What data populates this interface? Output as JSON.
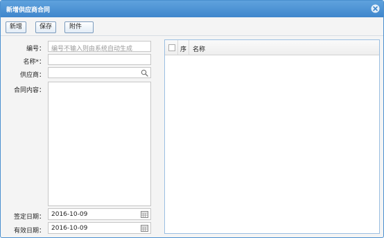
{
  "window": {
    "title": "新增供应商合同"
  },
  "toolbar": {
    "new_label": "新增",
    "save_label": "保存",
    "attach_label": "附件"
  },
  "form": {
    "code_label": "编号：",
    "code_placeholder": "编号不输入则由系统自动生成",
    "name_label": "名称",
    "name_required": "*",
    "name_colon": "：",
    "supplier_label": "供应商：",
    "content_label": "合同内容：",
    "sign_date_label": "签定日期：",
    "sign_date_value": "2016-10-09",
    "valid_date_label": "有效日期：",
    "valid_date_value": "2016-10-09"
  },
  "grid": {
    "columns": [
      "序",
      "名称"
    ]
  },
  "icons": {
    "close": "close-icon",
    "search": "search-icon",
    "calendar": "calendar-icon"
  },
  "colors": {
    "title_bar": "#3f86cc",
    "border": "#9bbfe2"
  }
}
